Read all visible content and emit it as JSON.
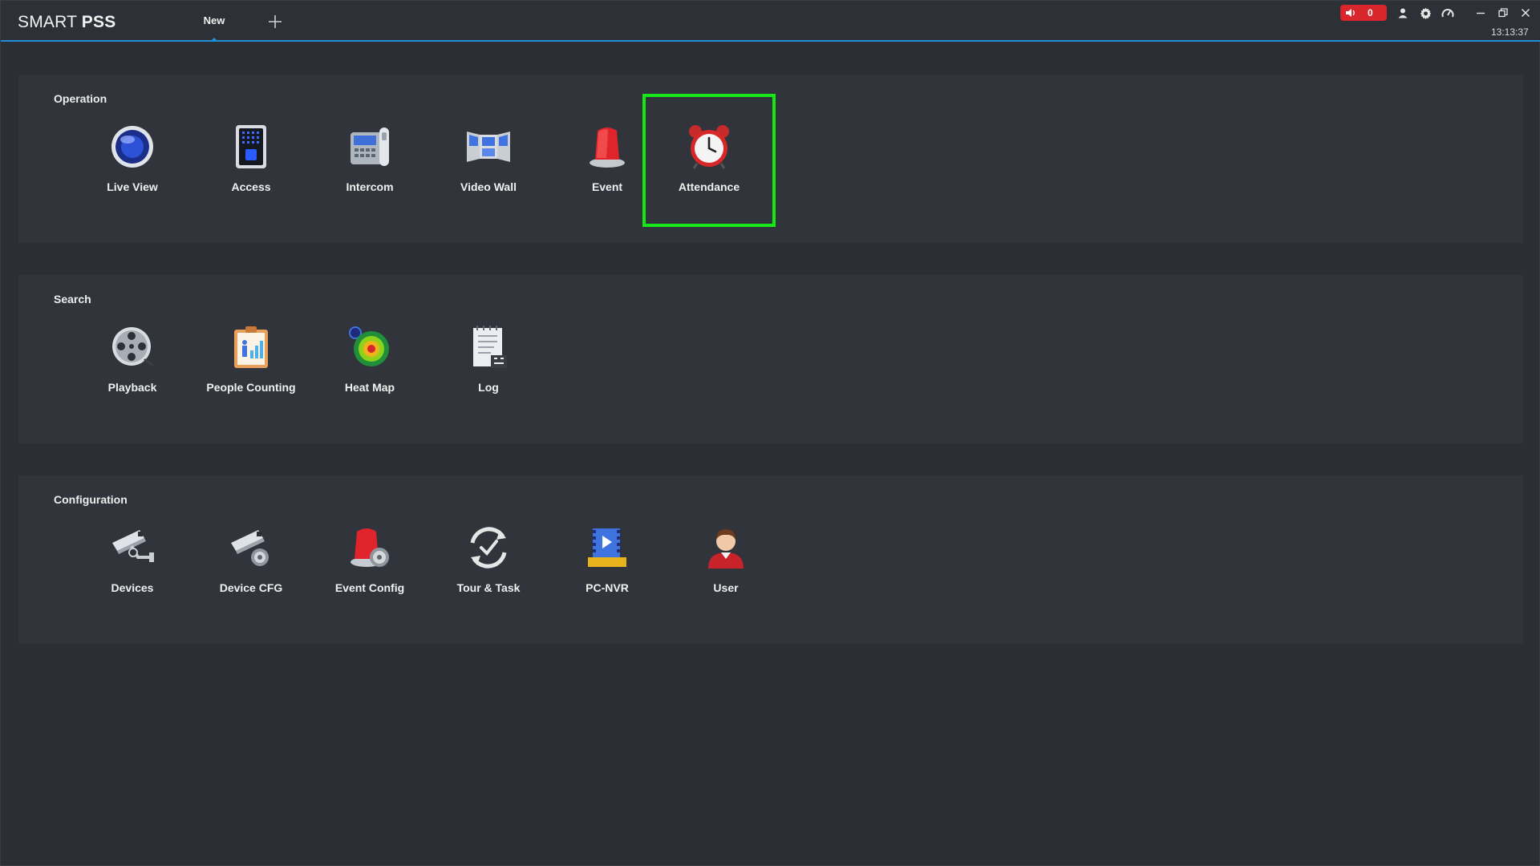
{
  "app": {
    "brand_light": "SMART",
    "brand_bold": "PSS"
  },
  "tabs": [
    {
      "label": "New"
    }
  ],
  "status": {
    "alarm_count": "0",
    "time": "13:13:37"
  },
  "colors": {
    "accent": "#1f8fd6",
    "alarm": "#d8262c",
    "selection": "#17e617"
  },
  "sections": {
    "operation": {
      "title": "Operation",
      "items": [
        {
          "label": "Live View",
          "icon": "live-view-icon"
        },
        {
          "label": "Access",
          "icon": "access-icon"
        },
        {
          "label": "Intercom",
          "icon": "intercom-icon"
        },
        {
          "label": "Video Wall",
          "icon": "video-wall-icon"
        },
        {
          "label": "Event",
          "icon": "event-icon"
        },
        {
          "label": "Attendance",
          "icon": "attendance-icon"
        }
      ]
    },
    "search": {
      "title": "Search",
      "items": [
        {
          "label": "Playback",
          "icon": "playback-icon"
        },
        {
          "label": "People Counting",
          "icon": "people-counting-icon"
        },
        {
          "label": "Heat Map",
          "icon": "heat-map-icon"
        },
        {
          "label": "Log",
          "icon": "log-icon"
        }
      ]
    },
    "configuration": {
      "title": "Configuration",
      "items": [
        {
          "label": "Devices",
          "icon": "devices-icon"
        },
        {
          "label": "Device CFG",
          "icon": "device-cfg-icon"
        },
        {
          "label": "Event Config",
          "icon": "event-config-icon"
        },
        {
          "label": "Tour & Task",
          "icon": "tour-task-icon"
        },
        {
          "label": "PC-NVR",
          "icon": "pc-nvr-icon"
        },
        {
          "label": "User",
          "icon": "user-icon"
        }
      ]
    }
  }
}
